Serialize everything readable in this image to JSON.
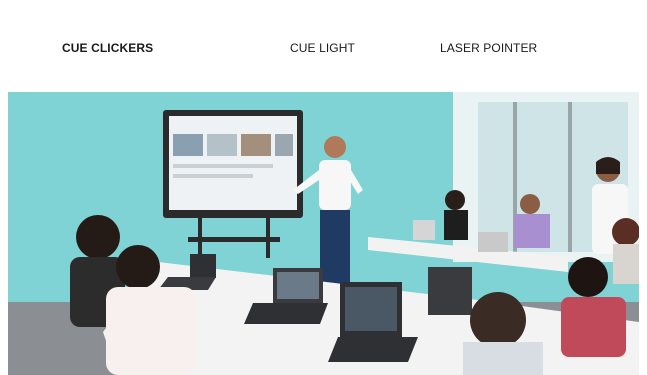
{
  "tabs": [
    {
      "label": "CUE CLICKERS",
      "active": true
    },
    {
      "label": "CUE LIGHT",
      "active": false
    },
    {
      "label": "LASER POINTER",
      "active": false
    }
  ],
  "hero": {
    "icon": "classroom-photo",
    "colors": {
      "wall": "#7fd3d4",
      "table": "#f3f3f3",
      "screen_frame": "#2b2b2b"
    }
  }
}
